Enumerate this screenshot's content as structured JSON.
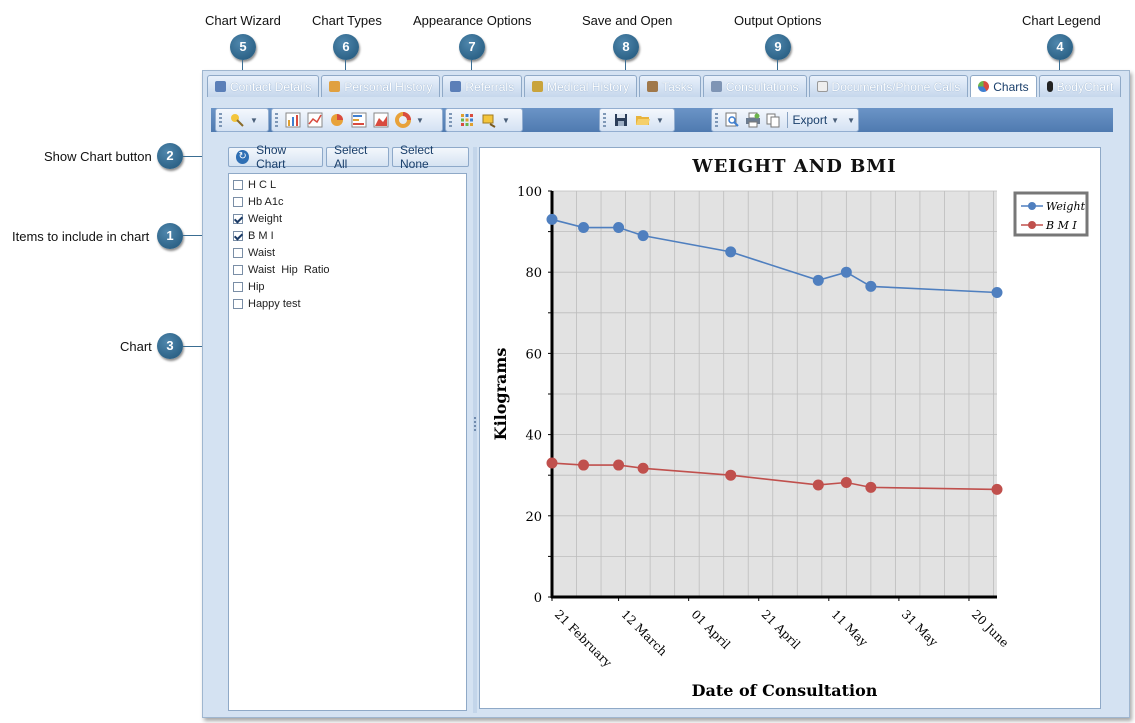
{
  "callouts": [
    {
      "num": "5",
      "label": "Chart Wizard"
    },
    {
      "num": "6",
      "label": "Chart Types"
    },
    {
      "num": "7",
      "label": "Appearance Options"
    },
    {
      "num": "8",
      "label": "Save and Open"
    },
    {
      "num": "9",
      "label": "Output Options"
    },
    {
      "num": "4",
      "label": "Chart Legend"
    },
    {
      "num": "2",
      "label": "Show Chart button"
    },
    {
      "num": "1",
      "label": "Items to include in chart"
    },
    {
      "num": "3",
      "label": "Chart"
    }
  ],
  "tabs": [
    {
      "label": "Contact Details",
      "icon": "contact-icon"
    },
    {
      "label": "Personal History",
      "icon": "pencil-icon"
    },
    {
      "label": "Referrals",
      "icon": "referral-icon"
    },
    {
      "label": "Medical History",
      "icon": "caduceus-icon"
    },
    {
      "label": "Tasks",
      "icon": "tasks-icon"
    },
    {
      "label": "Consultations",
      "icon": "calendar-icon"
    },
    {
      "label": "Documents/Phone Calls",
      "icon": "document-icon"
    },
    {
      "label": "Charts",
      "icon": "pie-chart-icon",
      "active": true
    },
    {
      "label": "BodyChart",
      "icon": "body-icon"
    }
  ],
  "toolbar": {
    "export_label": "Export"
  },
  "left_panel": {
    "show_chart_label": "Show Chart",
    "select_all_label": "Select All",
    "select_none_label": "Select None",
    "items": [
      {
        "label": "H C L",
        "checked": false
      },
      {
        "label": "Hb A1c",
        "checked": false
      },
      {
        "label": "Weight",
        "checked": true
      },
      {
        "label": "B M I",
        "checked": true
      },
      {
        "label": "Waist",
        "checked": false
      },
      {
        "label": "Waist  Hip  Ratio",
        "checked": false
      },
      {
        "label": "Hip",
        "checked": false
      },
      {
        "label": "Happy test",
        "checked": false
      }
    ]
  },
  "colors": {
    "weight": "#4f7fbf",
    "bmi": "#c0504d",
    "plot_bg": "#e2e2e2",
    "grid": "#bdbdbd"
  },
  "chart_data": {
    "type": "line",
    "title": "WEIGHT AND BMI",
    "xlabel": "Date of Consultation",
    "ylabel": "Kilograms",
    "ylim": [
      0,
      100
    ],
    "yticks": [
      "0",
      "20",
      "40",
      "60",
      "80",
      "100"
    ],
    "xlim": [
      "2009-02-21",
      "2009-06-28"
    ],
    "xticks": [
      {
        "date": "2009-02-21",
        "label": "21 February"
      },
      {
        "date": "2009-03-12",
        "label": "12 March"
      },
      {
        "date": "2009-04-01",
        "label": "01 April"
      },
      {
        "date": "2009-04-21",
        "label": "21 April"
      },
      {
        "date": "2009-05-11",
        "label": "11 May"
      },
      {
        "date": "2009-05-31",
        "label": "31 May"
      },
      {
        "date": "2009-06-20",
        "label": "20 June"
      }
    ],
    "grid": true,
    "legend_position": "right",
    "series": [
      {
        "name": "Weight",
        "x": [
          "2009-02-21",
          "2009-03-02",
          "2009-03-12",
          "2009-03-19",
          "2009-04-13",
          "2009-05-08",
          "2009-05-16",
          "2009-05-23",
          "2009-06-28"
        ],
        "y": [
          93,
          91,
          91,
          89,
          85,
          78,
          80,
          76.5,
          75
        ]
      },
      {
        "name": "B M I",
        "x": [
          "2009-02-21",
          "2009-03-02",
          "2009-03-12",
          "2009-03-19",
          "2009-04-13",
          "2009-05-08",
          "2009-05-16",
          "2009-05-23",
          "2009-06-28"
        ],
        "y": [
          33,
          32.5,
          32.5,
          31.7,
          30,
          27.6,
          28.2,
          27,
          26.5
        ]
      }
    ]
  }
}
